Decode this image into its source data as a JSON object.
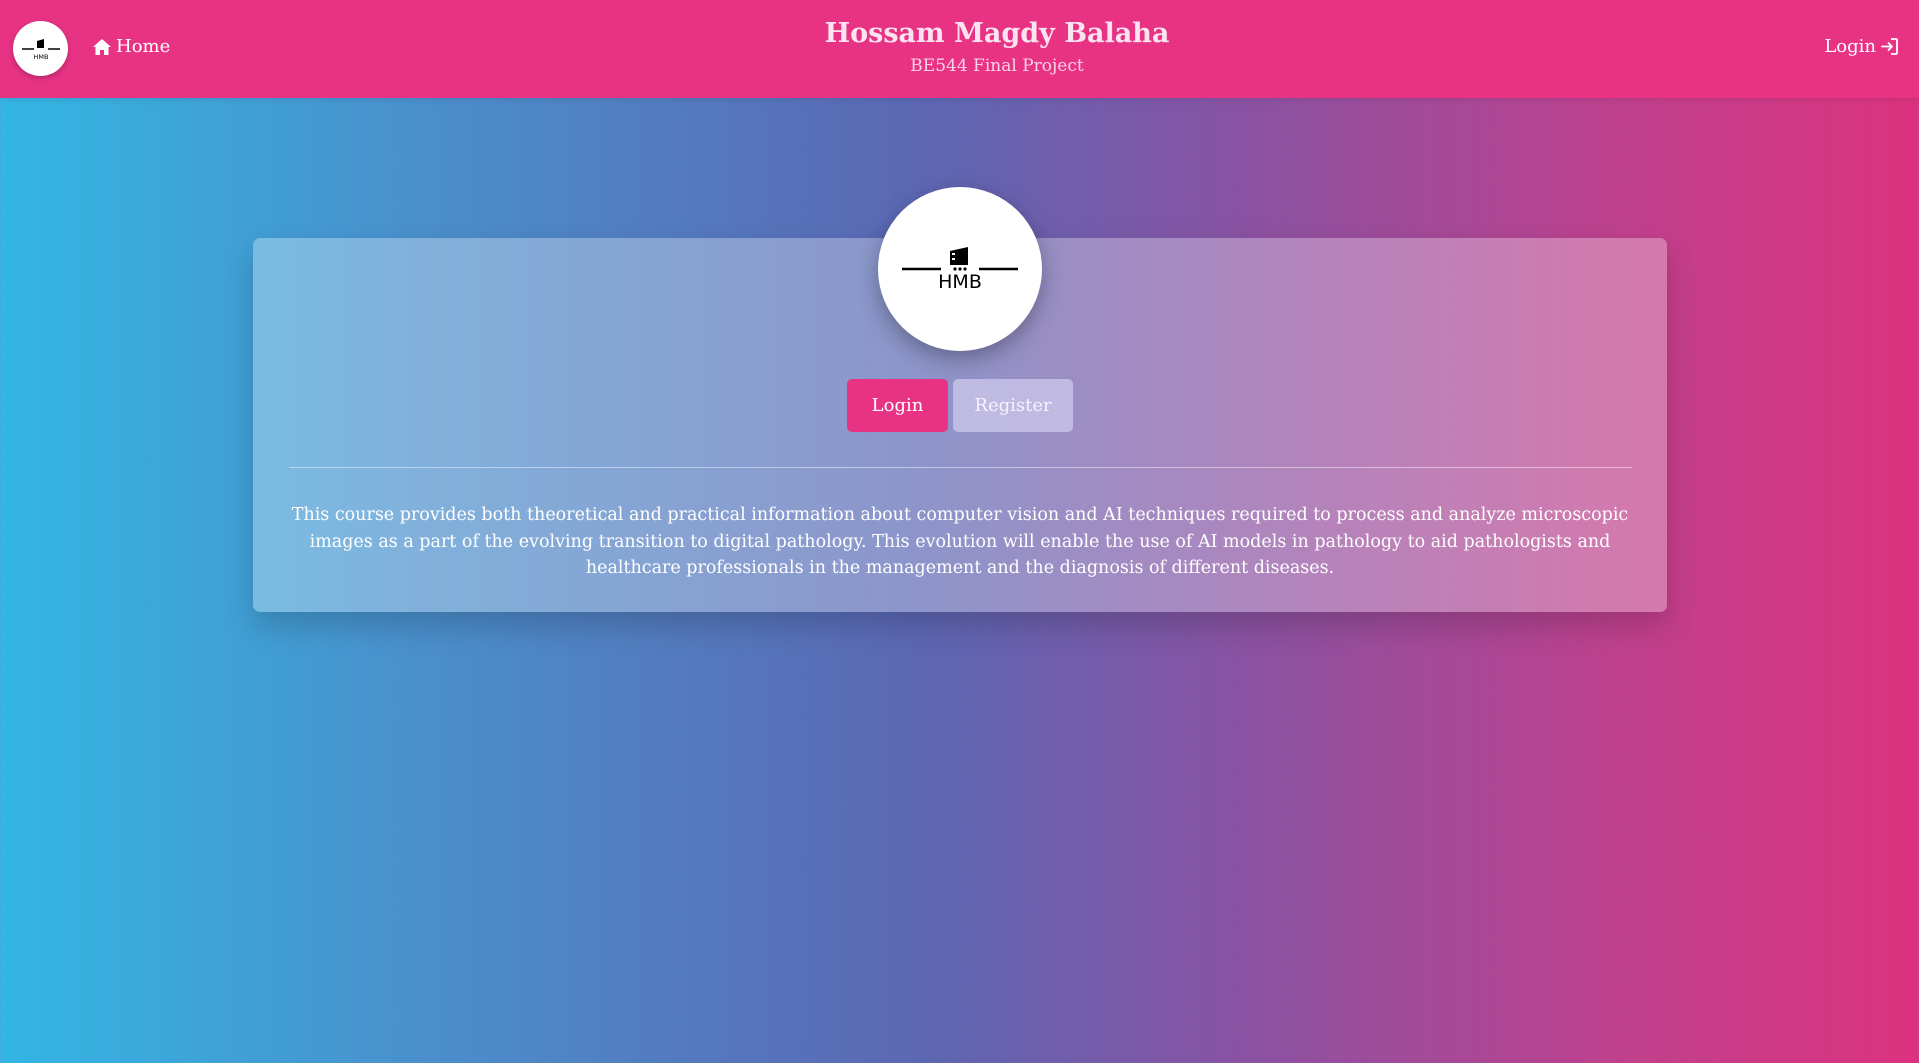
{
  "navbar": {
    "logo_text": "HMB",
    "home_label": "Home",
    "title": "Hossam Magdy Balaha",
    "subtitle": "BE544 Final Project",
    "login_label": "Login"
  },
  "card": {
    "logo_text": "HMB",
    "login_button": "Login",
    "register_button": "Register",
    "description": "This course provides both theoretical and practical information about computer vision and AI techniques required to process and analyze microscopic images as a part of the evolving transition to digital pathology. This evolution will enable the use of AI models in pathology to aid pathologists and healthcare professionals in the management and the diagnosis of different diseases."
  },
  "colors": {
    "navbar": "#e83385",
    "primary_button": "#e83385",
    "gradient_start": "#33b6e3",
    "gradient_end": "#db327f"
  },
  "icons": {
    "home": "home-icon",
    "login": "sign-in-icon",
    "logo": "building-icon"
  }
}
